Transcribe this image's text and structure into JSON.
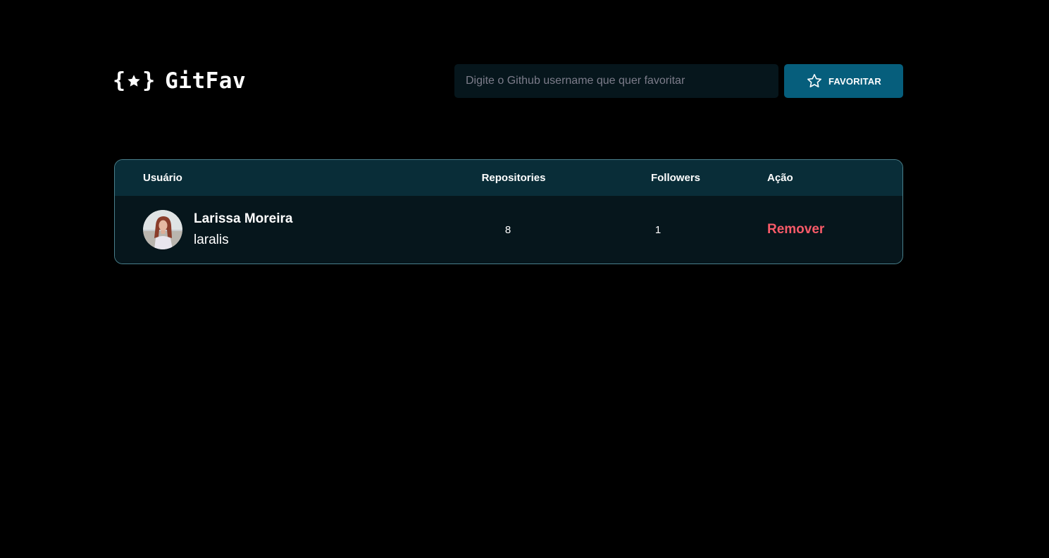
{
  "app": {
    "logo_text": "GitFav",
    "logo_icon": "star-braces-icon"
  },
  "search": {
    "placeholder": "Digite o Github username que quer favoritar",
    "value": "",
    "button_label": "FAVORITAR",
    "button_icon": "star-outline-icon"
  },
  "table": {
    "headers": {
      "user": "Usuário",
      "repositories": "Repositories",
      "followers": "Followers",
      "action": "Ação"
    },
    "rows": [
      {
        "name": "Larissa Moreira",
        "login": "laralis",
        "repositories": "8",
        "followers": "1",
        "action_label": "Remover",
        "avatar_icon": "avatar-photo"
      }
    ]
  },
  "colors": {
    "background": "#000000",
    "input_bg": "#06161c",
    "button_bg": "#065e7c",
    "table_header_bg": "#092d38",
    "table_border": "#4a808c",
    "remove_text": "#f75a68"
  }
}
